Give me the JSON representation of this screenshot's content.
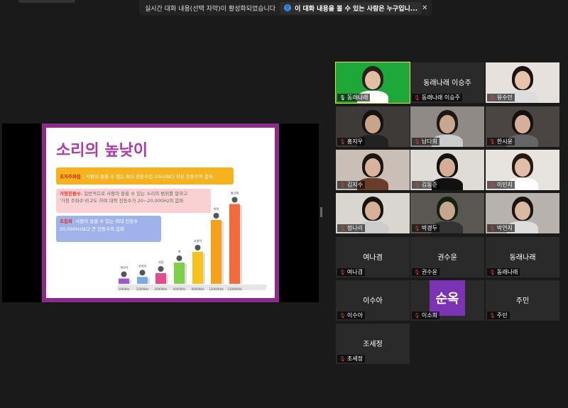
{
  "notice": {
    "message": "실시간 대화 내용(선택 자막)이 활성화되었습니다",
    "who_label": "이 대화 내용을 볼 수 있는 사람은 누구입니...",
    "close_icon": "close-icon"
  },
  "slide": {
    "title": "소리의 높낮이",
    "infrasound_key": "초저주파음",
    "infrasound_text": ": 사람이 들을 수 있는 최소 진동수인 20Hz보다 작은 진동수의 음파",
    "audible_key": "가청진동수",
    "audible_text": ": 일반적으로 사람이 들을 수 있는 소리의 범위를 말하고",
    "audible_text2": "'가청 주파수'라고도 하며 대략 진동수가 20~20,000Hz의 음파",
    "ultrasound_key": "초음파",
    "ultrasound_text": ": 사람이 들을 수 있는 최대 진동수",
    "ultrasound_text2": "20,000Hz보다 큰 진동수의 음파",
    "chart_data": {
      "type": "bar",
      "categories": [
        "1000Hz",
        "12000Hz",
        "20000Hz",
        "40000Hz",
        "60000Hz",
        "120000Hz",
        "150000Hz"
      ],
      "animals": [
        "개구리",
        "코끼리",
        "사람",
        "개",
        "고양이",
        "박쥐",
        "돌고래"
      ],
      "values": [
        1,
        1.3,
        2,
        4,
        6,
        12,
        15
      ],
      "colors": [
        "#9b59d0",
        "#7aa9e8",
        "#e44c8c",
        "#7ed04a",
        "#f6c21c",
        "#f7a11a",
        "#f46a3c"
      ],
      "title": "",
      "xlabel": "",
      "ylabel": ""
    }
  },
  "participants": [
    {
      "name": "동래나래",
      "mic": "on",
      "center": "",
      "active": true
    },
    {
      "name": "동래나래 이승주",
      "mic": "off",
      "center": "동래나래 이승주"
    },
    {
      "name": "유수민",
      "mic": "off",
      "center": ""
    },
    {
      "name": "홍지우",
      "mic": "off",
      "center": ""
    },
    {
      "name": "남다희",
      "mic": "off",
      "center": ""
    },
    {
      "name": "한시윤",
      "mic": "off",
      "center": ""
    },
    {
      "name": "김지수",
      "mic": "off",
      "center": ""
    },
    {
      "name": "김동준",
      "mic": "off",
      "center": ""
    },
    {
      "name": "이민지",
      "mic": "off",
      "center": ""
    },
    {
      "name": "정나리",
      "mic": "off",
      "center": ""
    },
    {
      "name": "박경두",
      "mic": "off",
      "center": ""
    },
    {
      "name": "박연지",
      "mic": "off",
      "center": ""
    },
    {
      "name": "여나겸",
      "mic": "off",
      "center": "여나겸"
    },
    {
      "name": "권수윤",
      "mic": "off",
      "center": "권수윤"
    },
    {
      "name": "동래나래",
      "mic": "off",
      "center": "동래나래"
    },
    {
      "name": "이수아",
      "mic": "off",
      "center": "이수아"
    },
    {
      "name": "이소희",
      "mic": "off",
      "center": "",
      "avatar": "순옥"
    },
    {
      "name": "주민",
      "mic": "off",
      "center": "주민"
    },
    {
      "name": "조세정",
      "mic": "off",
      "center": "조세정"
    }
  ],
  "colors": {
    "active_border": "#e4e33c",
    "muted_mic": "#e23b3b",
    "avatar_bg": "#7b33b3"
  }
}
